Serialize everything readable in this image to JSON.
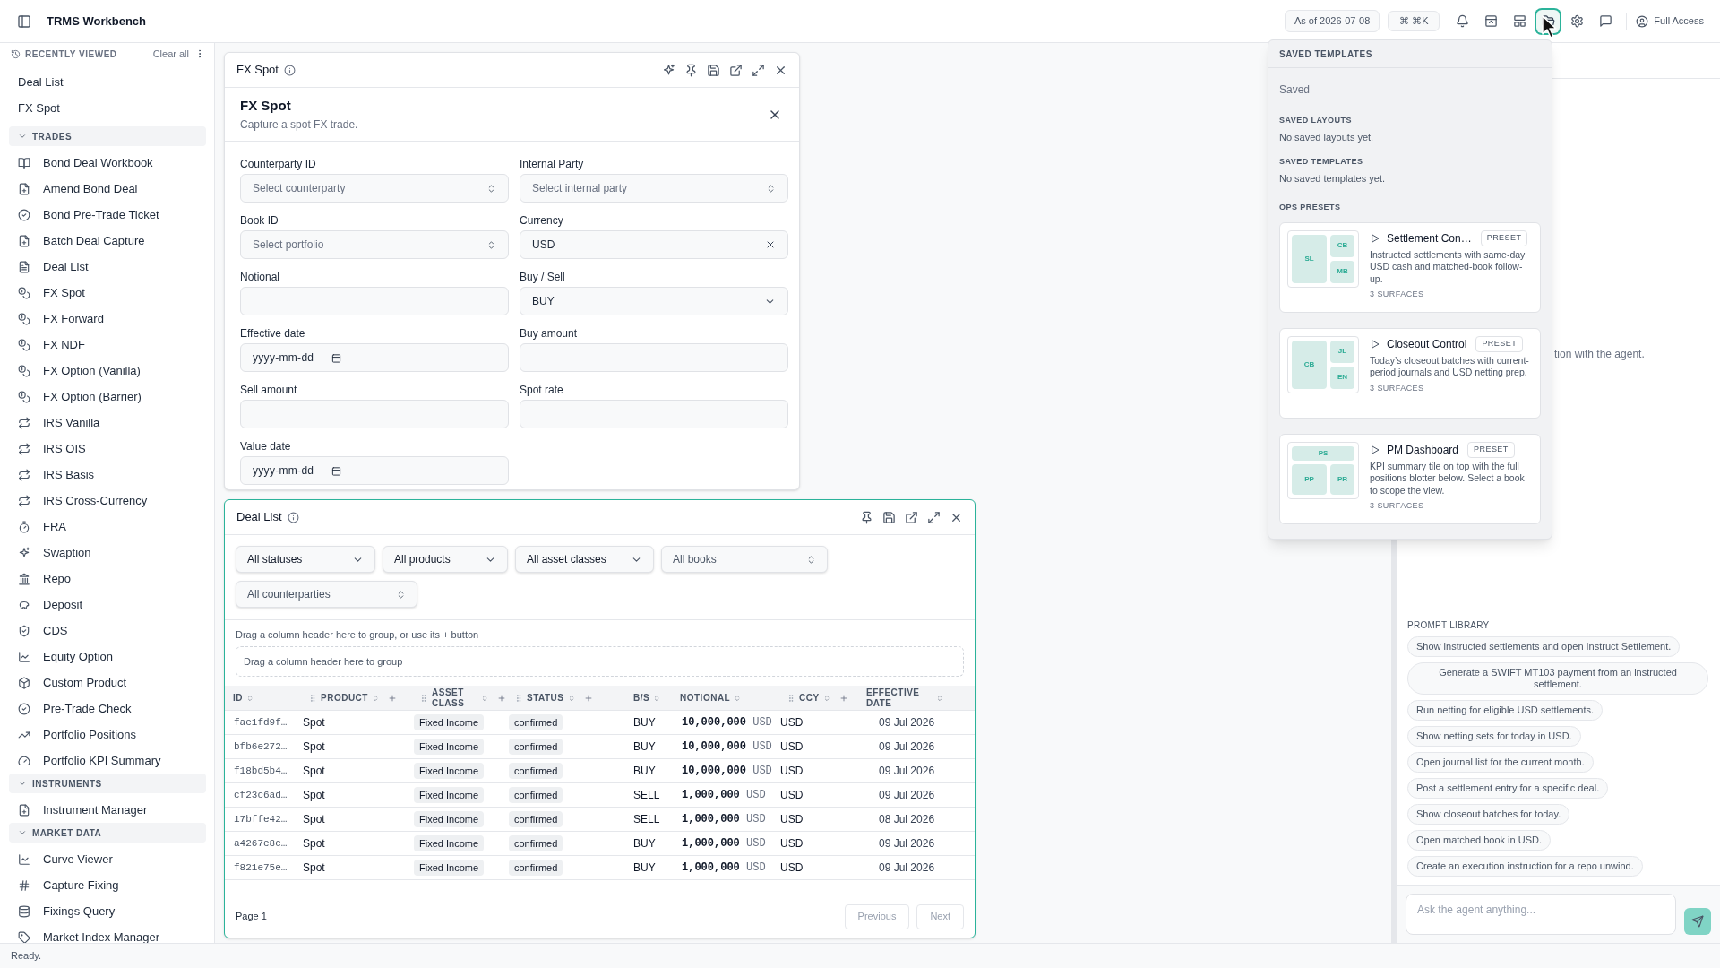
{
  "app": {
    "title": "TRMS Workbench"
  },
  "header": {
    "as_of": "As of 2026-07-08",
    "shortcut": "⌘ ⌘K",
    "tools": [
      {
        "selected": false
      },
      {
        "selected": false
      },
      {
        "selected": false
      },
      {
        "selected": true
      },
      {
        "selected": false
      },
      {
        "selected": false
      }
    ],
    "account": "Full Access"
  },
  "sidebar": {
    "recent": {
      "title": "RECENTLY VIEWED",
      "action": "Clear all",
      "items": [
        "Deal List",
        "FX Spot"
      ]
    },
    "sections": [
      {
        "title": "TRADES",
        "expanded": true,
        "items": [
          "Bond Deal Workbook",
          "Amend Bond Deal",
          "Bond Pre-Trade Ticket",
          "Batch Deal Capture",
          "Deal List",
          "FX Spot",
          "FX Forward",
          "FX NDF",
          "FX Option (Vanilla)",
          "FX Option (Barrier)",
          "IRS Vanilla",
          "IRS OIS",
          "IRS Basis",
          "IRS Cross-Currency",
          "FRA",
          "Swaption",
          "Repo",
          "Deposit",
          "CDS",
          "Equity Option",
          "Custom Product",
          "Pre-Trade Check",
          "Portfolio Positions",
          "Portfolio KPI Summary"
        ]
      },
      {
        "title": "INSTRUMENTS",
        "expanded": true,
        "items": [
          "Instrument Manager"
        ]
      },
      {
        "title": "MARKET DATA",
        "expanded": true,
        "items": [
          "Curve Viewer",
          "Capture Fixing",
          "Fixings Query",
          "Market Index Manager"
        ]
      }
    ]
  },
  "fx_panel": {
    "title": "FX Spot",
    "focused": false,
    "assist": true,
    "form_title": "FX Spot",
    "form_subtitle": "Capture a spot FX trade.",
    "fields": [
      {
        "label": "Counterparty ID",
        "kind": "select",
        "placeholder": "Select counterparty"
      },
      {
        "label": "Internal Party",
        "kind": "select",
        "placeholder": "Select internal party"
      },
      {
        "label": "Book ID",
        "kind": "select",
        "placeholder": "Select portfolio"
      },
      {
        "label": "Currency",
        "kind": "clearable",
        "value": "USD"
      },
      {
        "label": "Notional",
        "kind": "input"
      },
      {
        "label": "Buy / Sell",
        "kind": "dropdown",
        "value": "BUY"
      },
      {
        "label": "Effective date",
        "kind": "date",
        "placeholder": "yyyy-mm-dd"
      },
      {
        "label": "Buy amount",
        "kind": "input"
      },
      {
        "label": "Sell amount",
        "kind": "input"
      },
      {
        "label": "Spot rate",
        "kind": "input"
      },
      {
        "label": "Value date",
        "kind": "date",
        "placeholder": "yyyy-mm-dd"
      }
    ]
  },
  "deal_panel": {
    "title": "Deal List",
    "focused": true,
    "assist": false,
    "filters": [
      {
        "label": "All statuses",
        "kind": "dropdown"
      },
      {
        "label": "All products",
        "kind": "dropdown"
      },
      {
        "label": "All asset classes",
        "kind": "dropdown"
      },
      {
        "label": "All books",
        "kind": "combobox"
      },
      {
        "label": "All counterparties",
        "kind": "combobox"
      }
    ],
    "group_hint": "Drag a column header here to group, or use its + button",
    "drop_zone": "Drag a column header here to group",
    "columns": [
      {
        "label": "ID",
        "groupable": false
      },
      {
        "label": "PRODUCT",
        "groupable": true
      },
      {
        "label": "ASSET CLASS",
        "groupable": true
      },
      {
        "label": "STATUS",
        "groupable": true
      },
      {
        "label": "B/S",
        "groupable": false
      },
      {
        "label": "NOTIONAL",
        "groupable": false
      },
      {
        "label": "CCY",
        "groupable": true
      },
      {
        "label": "EFFECTIVE DATE",
        "groupable": false
      }
    ],
    "rows": [
      {
        "id": "fae1fd9f…",
        "product": "Spot",
        "asset_class": "Fixed Income",
        "status": "confirmed",
        "side": "BUY",
        "notional": "10,000,000",
        "notional_ccy": "USD",
        "ccy": "USD",
        "effective_date": "09 Jul 2026"
      },
      {
        "id": "bfb6e272…",
        "product": "Spot",
        "asset_class": "Fixed Income",
        "status": "confirmed",
        "side": "BUY",
        "notional": "10,000,000",
        "notional_ccy": "USD",
        "ccy": "USD",
        "effective_date": "09 Jul 2026"
      },
      {
        "id": "f18bd5b4…",
        "product": "Spot",
        "asset_class": "Fixed Income",
        "status": "confirmed",
        "side": "BUY",
        "notional": "10,000,000",
        "notional_ccy": "USD",
        "ccy": "USD",
        "effective_date": "09 Jul 2026"
      },
      {
        "id": "cf23c6ad…",
        "product": "Spot",
        "asset_class": "Fixed Income",
        "status": "confirmed",
        "side": "SELL",
        "notional": "1,000,000",
        "notional_ccy": "USD",
        "ccy": "USD",
        "effective_date": "09 Jul 2026"
      },
      {
        "id": "17bffe42…",
        "product": "Spot",
        "asset_class": "Fixed Income",
        "status": "confirmed",
        "side": "SELL",
        "notional": "1,000,000",
        "notional_ccy": "USD",
        "ccy": "USD",
        "effective_date": "08 Jul 2026"
      },
      {
        "id": "a4267e8c…",
        "product": "Spot",
        "asset_class": "Fixed Income",
        "status": "confirmed",
        "side": "BUY",
        "notional": "1,000,000",
        "notional_ccy": "USD",
        "ccy": "USD",
        "effective_date": "09 Jul 2026"
      },
      {
        "id": "f821e75e…",
        "product": "Spot",
        "asset_class": "Fixed Income",
        "status": "confirmed",
        "side": "BUY",
        "notional": "1,000,000",
        "notional_ccy": "USD",
        "ccy": "USD",
        "effective_date": "09 Jul 2026"
      }
    ],
    "page": "Page 1",
    "prev": {
      "label": "Previous",
      "disabled": true
    },
    "next": {
      "label": "Next",
      "disabled": true
    }
  },
  "popup": {
    "title": "SAVED TEMPLATES",
    "saved": "Saved",
    "sections": [
      {
        "title": "SAVED LAYOUTS",
        "empty": "No saved layouts yet."
      },
      {
        "title": "SAVED TEMPLATES",
        "empty": "No saved templates yet."
      }
    ],
    "presets_title": "OPS PRESETS",
    "presets": [
      {
        "title": "Settlement Con…",
        "badge": "PRESET",
        "description": "Instructed settlements with same-day USD cash and matched-book follow-up.",
        "surfaces": "3 SURFACES",
        "kind": "split",
        "tiles": [
          "SL",
          "CB",
          "MB"
        ]
      },
      {
        "title": "Closeout Control",
        "badge": "PRESET",
        "description": "Today’s closeout batches with current-period journals and USD netting prep.",
        "surfaces": "3 SURFACES",
        "kind": "split",
        "tiles": [
          "CB",
          "JL",
          "EN"
        ]
      },
      {
        "title": "PM Dashboard",
        "badge": "PRESET",
        "description": "KPI summary tile on top with the full positions blotter below. Select a book to scope the view.",
        "surfaces": "3 SURFACES",
        "kind": "top",
        "tiles": [
          "PS",
          "PP",
          "PR"
        ]
      }
    ]
  },
  "agent": {
    "note": "tion with the agent.",
    "library_title": "PROMPT LIBRARY",
    "prompts": [
      "Show instructed settlements and open Instruct Settlement.",
      "Generate a SWIFT MT103 payment from an instructed settlement.",
      "Run netting for eligible USD settlements.",
      "Show netting sets for today in USD.",
      "Open journal list for the current month.",
      "Post a settlement entry for a specific deal.",
      "Show closeout batches for today.",
      "Open matched book in USD.",
      "Create an execution instruction for a repo unwind."
    ],
    "input_placeholder": "Ask the agent anything..."
  },
  "status_bar": {
    "text": "Ready."
  }
}
